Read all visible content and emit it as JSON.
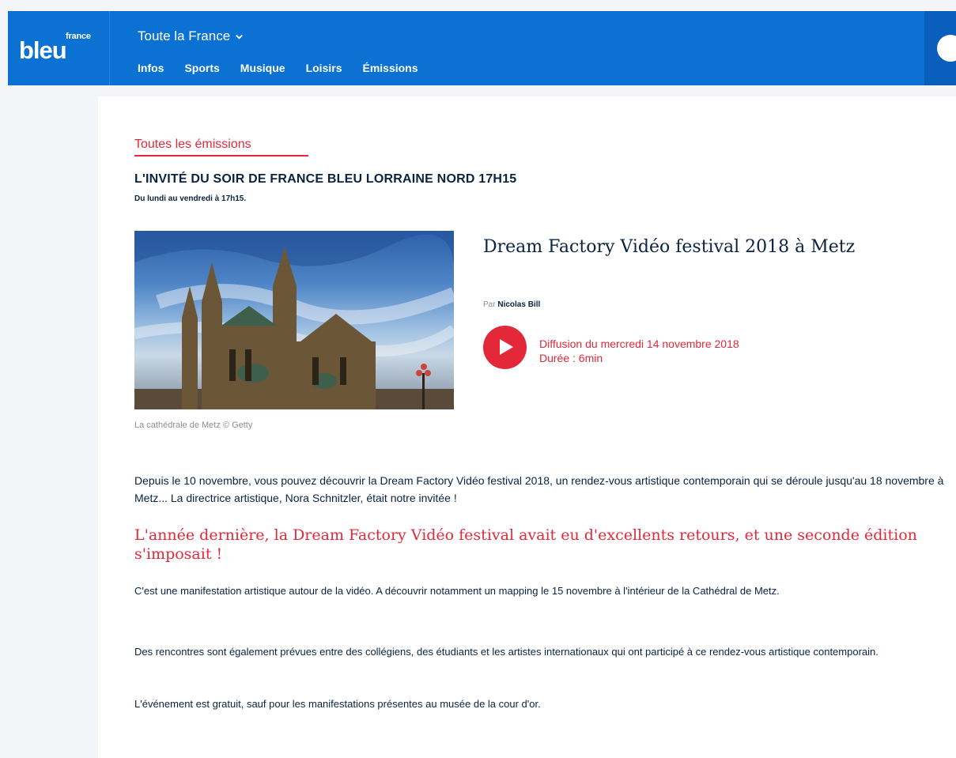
{
  "header": {
    "logo_small": "france",
    "logo_big": "bleu",
    "region": "Toute la France",
    "nav": [
      "Infos",
      "Sports",
      "Musique",
      "Loisirs",
      "Émissions"
    ]
  },
  "show": {
    "all_link": "Toutes les émissions",
    "title": "L'INVITÉ DU SOIR DE FRANCE BLEU LORRAINE NORD 17H15",
    "schedule": "Du lundi au vendredi à 17h15."
  },
  "episode": {
    "image_caption": "La cathédrale de Metz © Getty",
    "title": "Dream Factory Vidéo festival 2018 à Metz",
    "by_prefix": "Par",
    "author": "Nicolas Bill",
    "broadcast": "Diffusion du mercredi 14 novembre 2018",
    "duration": "Durée : 6min"
  },
  "article": {
    "lead": "Depuis le 10 novembre, vous pouvez découvrir la Dream Factory Vidéo festival 2018, un rendez-vous artistique contemporain qui se déroule jusqu'au 18 novembre à Metz... La directrice artistique, Nora Schnitzler, était notre invitée !",
    "heading": "L'année dernière, la Dream Factory Vidéo festival avait eu d'excellents retours, et une seconde édition s'imposait !",
    "p1": "C'est une manifestation artistique autour de la vidéo. A découvrir notamment un mapping le 15 novembre à l'intérieur de la Cathédral de Metz.",
    "p2": "Des rencontres sont également prévues entre des collégiens, des étudiants et les artistes internationaux qui ont participé à ce rendez-vous artistique contemporain.",
    "p3": "L'événement est gratuit, sauf pour les manifestations présentes au musée de la cour d'or."
  },
  "colors": {
    "brand_blue": "#0b72d3",
    "accent_red": "#e3283a",
    "text_navy": "#0a2340"
  }
}
